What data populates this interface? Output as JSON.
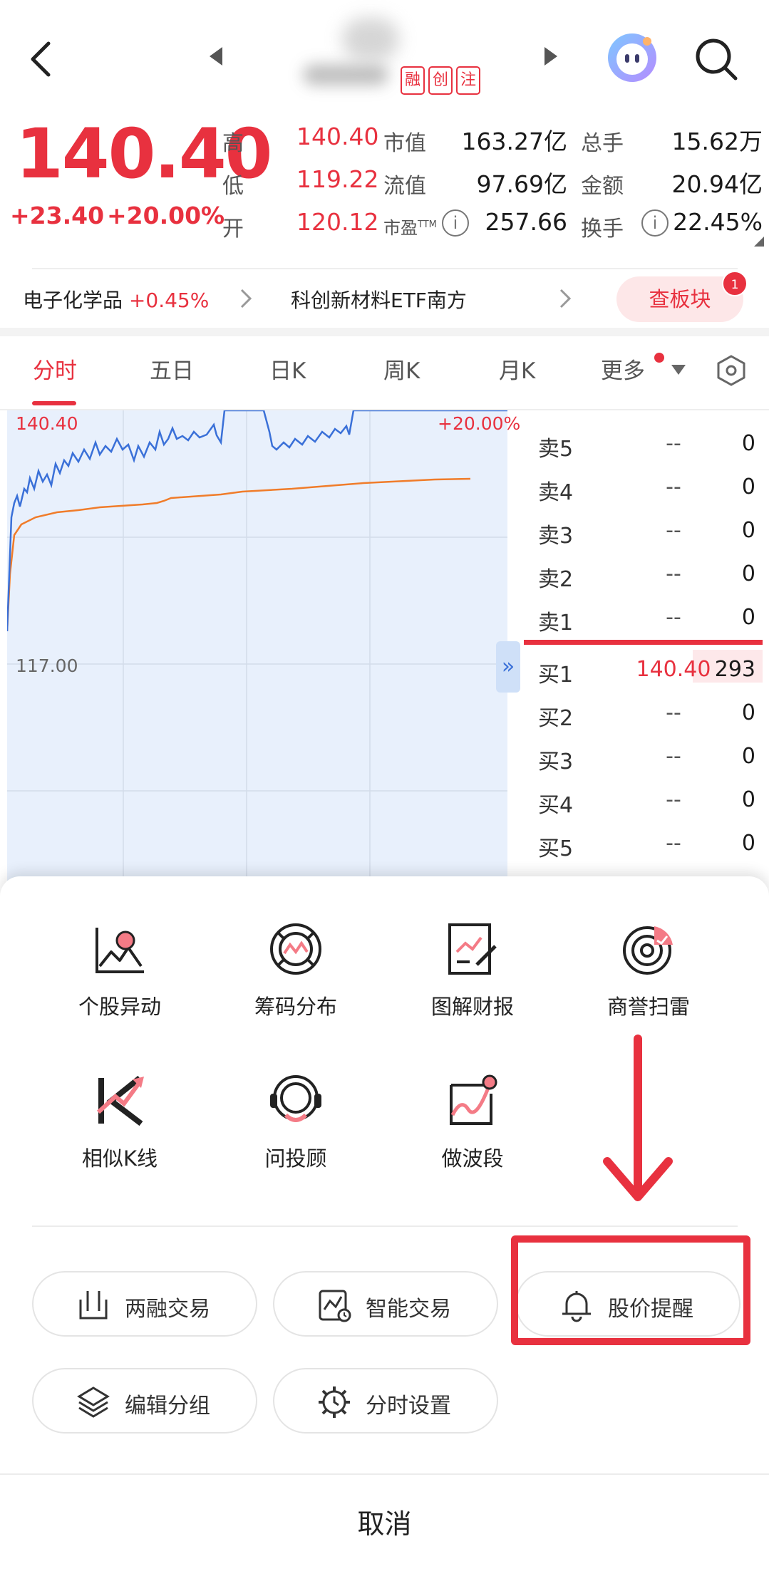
{
  "header": {
    "badges": [
      "融",
      "创",
      "注"
    ]
  },
  "quote": {
    "price": "140.40",
    "change": "+23.40",
    "change_pct": "+20.00%",
    "high_label": "高",
    "high": "140.40",
    "low_label": "低",
    "low": "119.22",
    "open_label": "开",
    "open": "120.12",
    "mktcap_label": "市值",
    "mktcap": "163.27亿",
    "float_label": "流值",
    "float": "97.69亿",
    "pe_label": "市盈",
    "pe_sup": "TTM",
    "pe": "257.66",
    "volume_label": "总手",
    "volume": "15.62万",
    "amount_label": "金额",
    "amount": "20.94亿",
    "turnover_label": "换手",
    "turnover": "22.45%",
    "info_glyph": "i"
  },
  "sector": {
    "sector1_name": "电子化学品",
    "sector1_pct": "+0.45%",
    "sector2_name": "科创新材料ETF南方",
    "button": "查板块",
    "button_badge": "1"
  },
  "tabs": [
    "分时",
    "五日",
    "日K",
    "周K",
    "月K",
    "更多"
  ],
  "chart": {
    "top_price": "140.40",
    "top_pct": "+20.00%",
    "mid_price": "117.00",
    "expand_glyph": "»",
    "price_line_color": "#3a70d8",
    "avg_line_color": "#f07c2a"
  },
  "orderbook": {
    "asks": [
      {
        "name": "卖5",
        "price": "--",
        "vol": "0"
      },
      {
        "name": "卖4",
        "price": "--",
        "vol": "0"
      },
      {
        "name": "卖3",
        "price": "--",
        "vol": "0"
      },
      {
        "name": "卖2",
        "price": "--",
        "vol": "0"
      },
      {
        "name": "卖1",
        "price": "--",
        "vol": "0"
      }
    ],
    "bids": [
      {
        "name": "买1",
        "price": "140.40",
        "vol": "293"
      },
      {
        "name": "买2",
        "price": "--",
        "vol": "0"
      },
      {
        "name": "买3",
        "price": "--",
        "vol": "0"
      },
      {
        "name": "买4",
        "price": "--",
        "vol": "0"
      },
      {
        "name": "买5",
        "price": "--",
        "vol": "0"
      }
    ]
  },
  "sheet": {
    "tools_row1": [
      {
        "label": "个股异动",
        "icon": "stock-movement-icon"
      },
      {
        "label": "筹码分布",
        "icon": "chip-distribution-icon"
      },
      {
        "label": "图解财报",
        "icon": "financial-report-icon"
      },
      {
        "label": "商誉扫雷",
        "icon": "goodwill-scan-icon"
      }
    ],
    "tools_row2": [
      {
        "label": "相似K线",
        "icon": "similar-kline-icon"
      },
      {
        "label": "问投顾",
        "icon": "advisor-icon"
      },
      {
        "label": "做波段",
        "icon": "swing-trade-icon"
      }
    ],
    "pills": [
      {
        "label": "两融交易",
        "icon": "margin-trade-icon"
      },
      {
        "label": "智能交易",
        "icon": "smart-trade-icon"
      },
      {
        "label": "股价提醒",
        "icon": "bell-icon"
      },
      {
        "label": "编辑分组",
        "icon": "layers-icon"
      },
      {
        "label": "分时设置",
        "icon": "clock-gear-icon"
      }
    ],
    "cancel": "取消"
  },
  "colors": {
    "accent_red": "#e8313f",
    "chart_bg": "#e8f0fc"
  }
}
